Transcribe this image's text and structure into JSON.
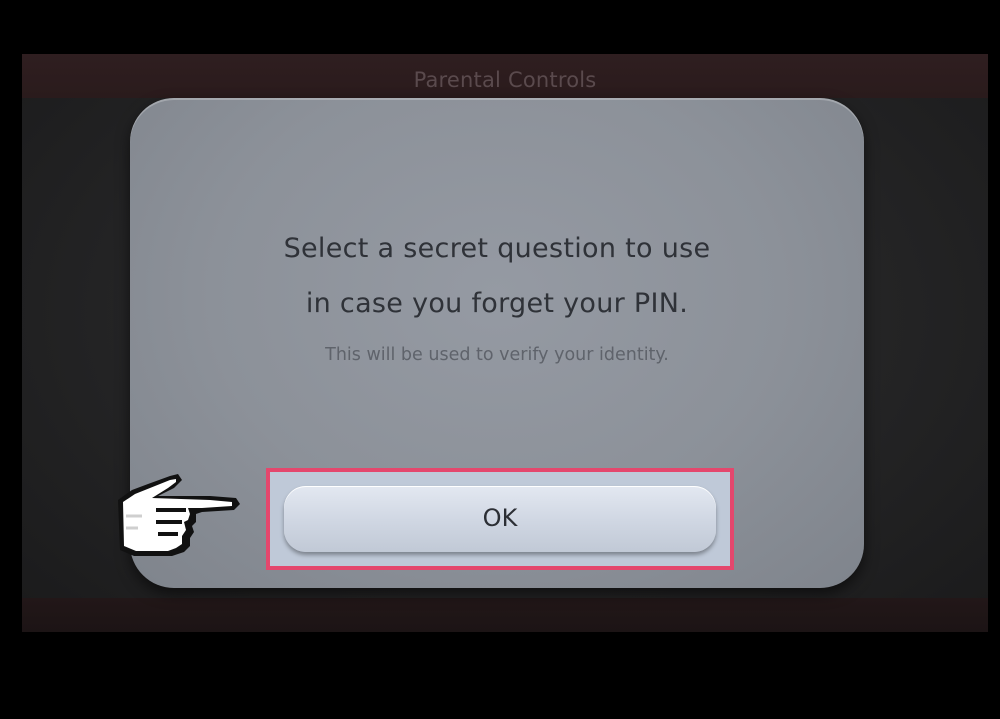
{
  "header": {
    "title": "Parental Controls"
  },
  "dialog": {
    "message_line_1": "Select a secret question to use",
    "message_line_2": "in case you forget your PIN.",
    "sub_message": "This will be used to verify your identity.",
    "ok_label": "OK"
  },
  "colors": {
    "highlight": "#e4476d",
    "dialog_background": "#8c9199",
    "title_bar": "#2f1e20"
  },
  "icons": {
    "pointer": "pointing-hand-icon"
  }
}
